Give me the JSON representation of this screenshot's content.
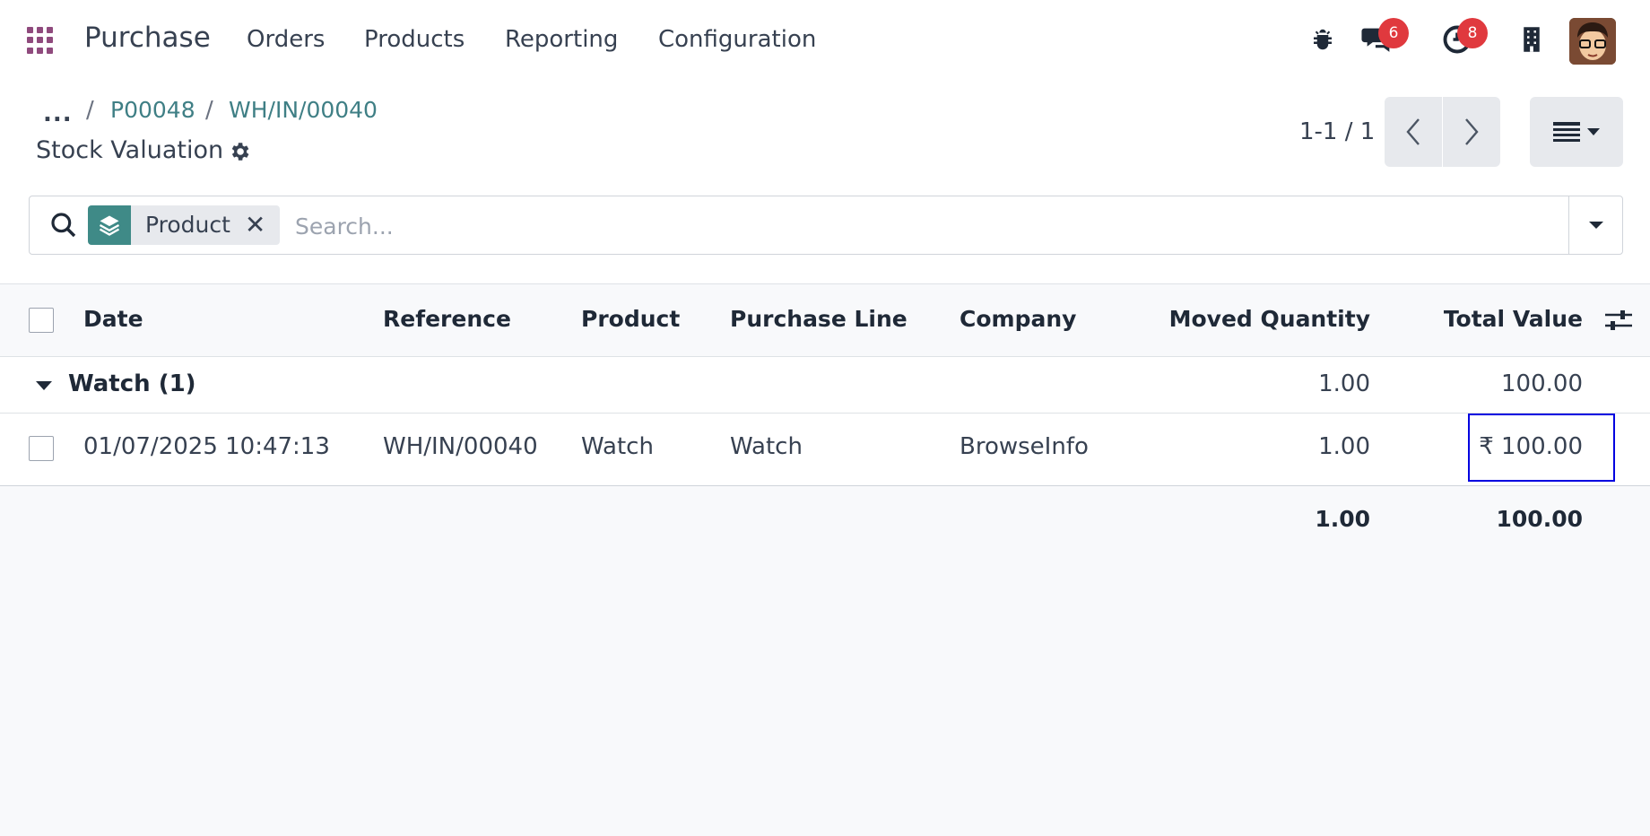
{
  "topbar": {
    "app_title": "Purchase",
    "nav": [
      "Orders",
      "Products",
      "Reporting",
      "Configuration"
    ],
    "messages_badge": "6",
    "activities_badge": "8"
  },
  "breadcrumb": {
    "dots": "...",
    "sep": "/",
    "items": [
      "P00048",
      "WH/IN/00040"
    ]
  },
  "page": {
    "title": "Stock Valuation"
  },
  "pager": {
    "value": "1-1 / 1"
  },
  "search": {
    "facet_label": "Product",
    "placeholder": "Search..."
  },
  "table": {
    "columns": [
      "Date",
      "Reference",
      "Product",
      "Purchase Line",
      "Company",
      "Moved Quantity",
      "Total Value"
    ],
    "group": {
      "label": "Watch (1)",
      "moved_quantity": "1.00",
      "total_value": "100.00"
    },
    "rows": [
      {
        "date": "01/07/2025 10:47:13",
        "reference": "WH/IN/00040",
        "product": "Watch",
        "purchase_line": "Watch",
        "company": "BrowseInfo",
        "moved_quantity": "1.00",
        "total_value": "₹ 100.00"
      }
    ],
    "totals": {
      "moved_quantity": "1.00",
      "total_value": "100.00"
    }
  },
  "colors": {
    "brand": "#8f4a7d",
    "link": "#3f7f85",
    "badge": "#e0393e",
    "highlight": "#0000e0"
  }
}
